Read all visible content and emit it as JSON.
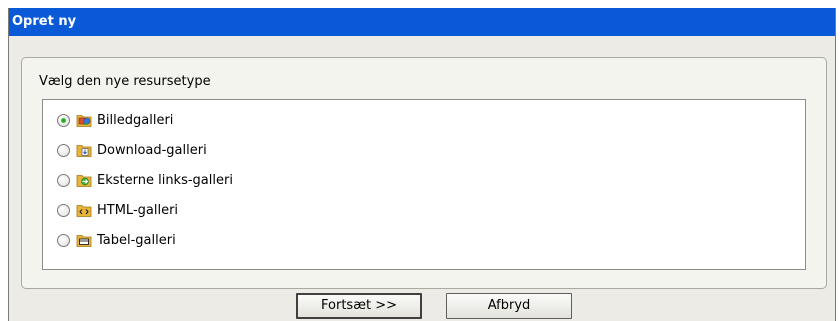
{
  "dialog": {
    "title": "Opret ny",
    "prompt": "Vælg den nye resursetype",
    "options": [
      {
        "label": "Billedgalleri",
        "icon": "image-gallery-icon",
        "selected": true
      },
      {
        "label": "Download-galleri",
        "icon": "download-gallery-icon",
        "selected": false
      },
      {
        "label": "Eksterne links-galleri",
        "icon": "external-links-gallery-icon",
        "selected": false
      },
      {
        "label": "HTML-galleri",
        "icon": "html-gallery-icon",
        "selected": false
      },
      {
        "label": "Tabel-galleri",
        "icon": "table-gallery-icon",
        "selected": false
      }
    ],
    "continue_label": "Fortsæt >>",
    "cancel_label": "Afbryd"
  },
  "colors": {
    "titlebar": "#0a5ad8",
    "dialog_bg": "#ecebe6",
    "folder": "#e8b43a"
  }
}
